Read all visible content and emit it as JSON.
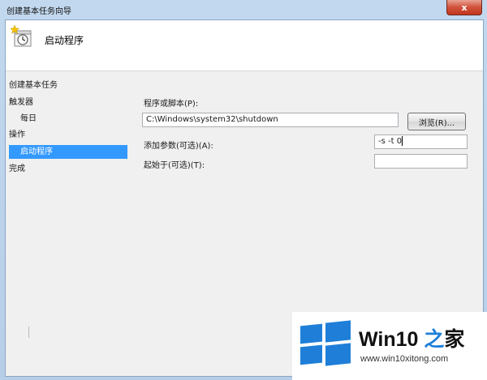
{
  "window": {
    "title": "创建基本任务向导",
    "close_glyph": "x"
  },
  "header": {
    "title": "启动程序",
    "icon": "task-clock-icon"
  },
  "steps": [
    {
      "label": "创建基本任务",
      "selected": false
    },
    {
      "label": "触发器",
      "selected": false
    },
    {
      "label": "每日",
      "selected": false
    },
    {
      "label": "操作",
      "selected": false
    },
    {
      "label": "启动程序",
      "selected": true
    },
    {
      "label": "完成",
      "selected": false
    }
  ],
  "form": {
    "program_label": "程序或脚本(P):",
    "program_value": "C:\\Windows\\system32\\shutdown",
    "browse_label": "浏览(R)...",
    "args_label": "添加参数(可选)(A):",
    "args_value": "-s -t 0",
    "start_in_label": "起始于(可选)(T):",
    "start_in_value": ""
  },
  "watermark": {
    "brand_prefix": "Win10 ",
    "brand_zhi": "之",
    "brand_suffix": "家",
    "url": "www.win10xitong.com"
  },
  "colors": {
    "selection": "#3399ff",
    "win_logo_blue": "#1f7fd8"
  }
}
